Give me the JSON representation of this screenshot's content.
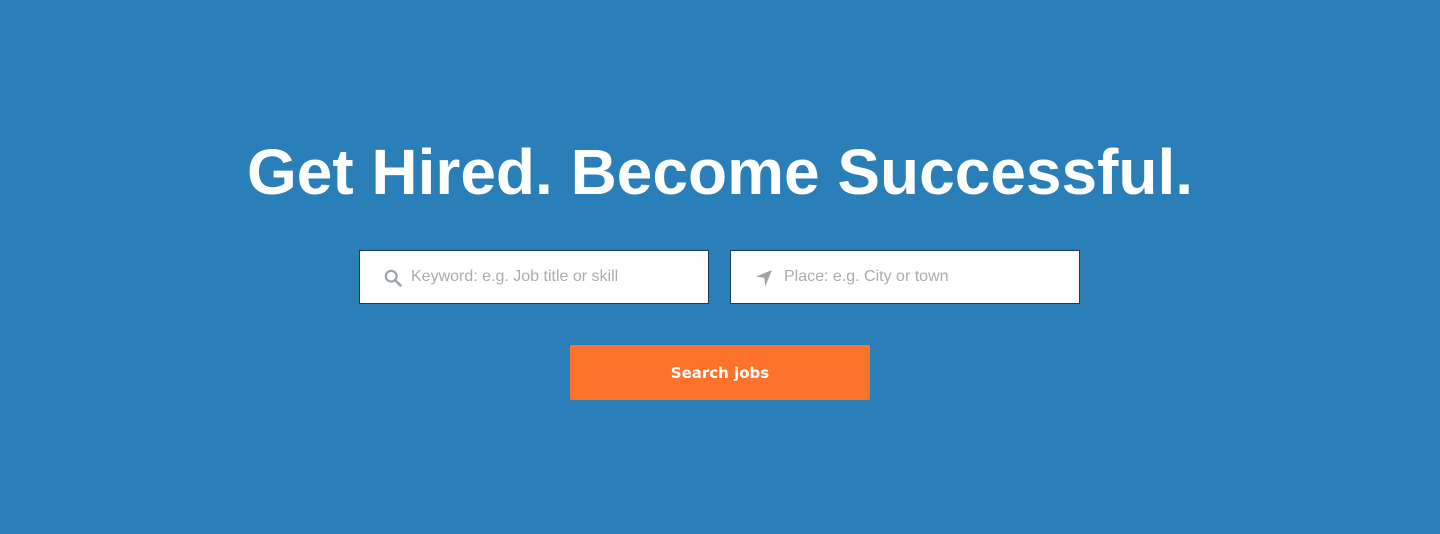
{
  "theme": {
    "background_color": "#2a7fb8",
    "button_color": "#ff722b",
    "icon_color": "#9ea3a8"
  },
  "hero": {
    "headline": "Get Hired. Become Successful."
  },
  "search": {
    "keyword": {
      "placeholder": "Keyword: e.g. Job title or skill",
      "value": "",
      "icon": "search-icon"
    },
    "place": {
      "placeholder": "Place: e.g. City or town",
      "value": "",
      "icon": "location-arrow-icon"
    },
    "button_label": "Search jobs"
  }
}
